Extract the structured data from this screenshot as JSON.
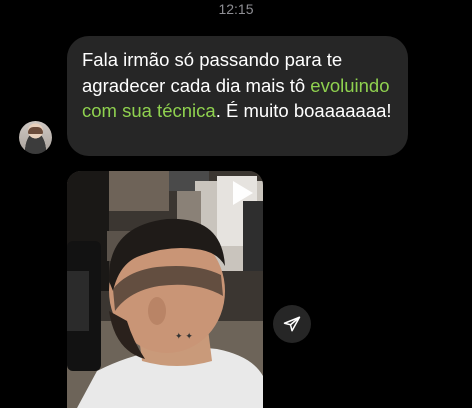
{
  "chat": {
    "timestamp": "12:15",
    "message": {
      "text_before_link": "Fala irmão só passando para te agradecer cada dia mais tô ",
      "link_text": "evoluindo com sua técnica",
      "text_after_link": ". É muito boaaaaaaa!"
    },
    "media": {
      "play_icon": "play-icon"
    },
    "share_icon": "send-icon"
  },
  "colors": {
    "background": "#000000",
    "bubble": "#262626",
    "link": "#8fd14f",
    "timestamp": "#8e8e93"
  }
}
